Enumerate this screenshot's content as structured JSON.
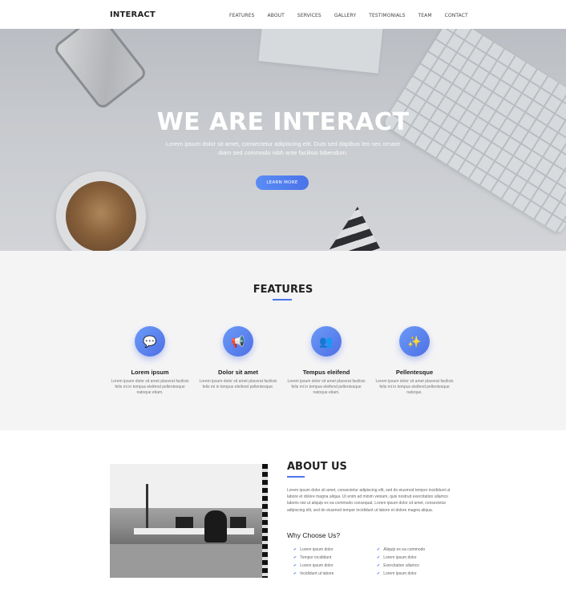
{
  "nav": {
    "brand": "INTERACT",
    "items": [
      "FEATURES",
      "ABOUT",
      "SERVICES",
      "GALLERY",
      "TESTIMONIALS",
      "TEAM",
      "CONTACT"
    ]
  },
  "hero": {
    "title": "WE ARE INTERACT",
    "subtitle": "Lorem ipsum dolor sit amet, consectetur adipiscing elit. Duis sed dapibus leo nec ornare diam sed commodo nibh ante facilisis bibendum.",
    "cta_label": "LEARN MORE"
  },
  "features": {
    "heading": "FEATURES",
    "items": [
      {
        "icon": "chat-bubbles-icon",
        "glyph": "💬",
        "title": "Lorem ipsum",
        "desc": "Lorem ipsum dolor sit amet placerat facilisis felis mi in tempus eleifend pellentesque natoque etiam."
      },
      {
        "icon": "megaphone-icon",
        "glyph": "📢",
        "title": "Dolor sit amet",
        "desc": "Lorem ipsum dolor sit amet placerat facilisis felis mi in tempus eleifend pellentesque."
      },
      {
        "icon": "group-icon",
        "glyph": "👥",
        "title": "Tempus eleifend",
        "desc": "Lorem ipsum dolor sit amet placerat facilisis felis mi in tempus eleifend pellentesque natoque etiam."
      },
      {
        "icon": "magic-wand-icon",
        "glyph": "✨",
        "title": "Pellentesque",
        "desc": "Lorem ipsum dolor sit amet placerat facilisis felis mi in tempus eleifend pellentesque natoque."
      }
    ]
  },
  "about": {
    "heading": "ABOUT US",
    "text": "Lorem ipsum dolor sit amet, consectetur adipiscing elit, sed do eiusmod tempor incididunt ut labore et dolore magna aliqua. Ut enim ad minim veniam, quis nostrud exercitation ullamco laboris nisi ut aliquip ex ea commodo consequat. Lorem ipsum dolor sit amet, consectetur adipiscing elit, sed do eiusmod tempor incididunt ut labore et dolore magna aliqua.",
    "why_heading": "Why Choose Us?",
    "list_left": [
      "Lorem ipsum dolor",
      "Tempor incididunt",
      "Lorem ipsum dolor",
      "Incididunt ut labore"
    ],
    "list_right": [
      "Aliquip ex ea commodo",
      "Lorem ipsum dolor",
      "Exercitation ullamco",
      "Lorem ipsum dolor"
    ]
  },
  "colors": {
    "accent": "#4a76ea",
    "accent_light": "#6a9bf7",
    "features_bg": "#f4f4f5"
  }
}
